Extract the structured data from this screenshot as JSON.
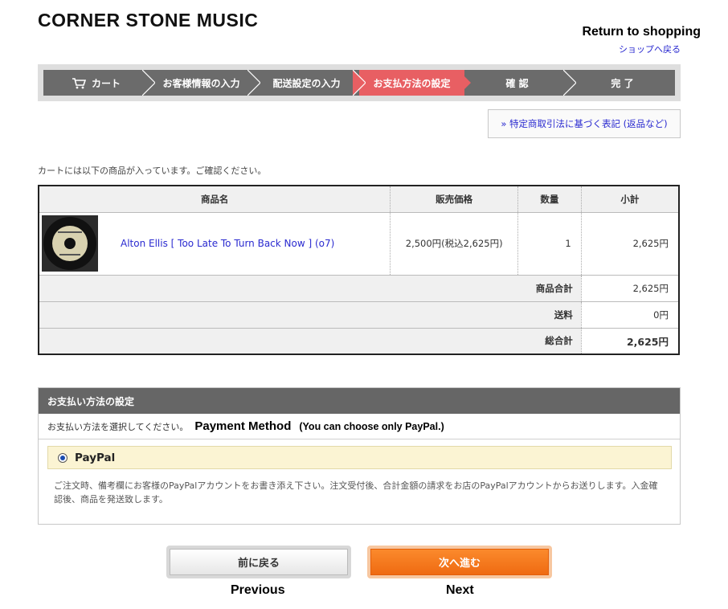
{
  "header": {
    "store_title": "CORNER STONE MUSIC",
    "return_en": "Return to shopping",
    "return_jp": "ショップへ戻る"
  },
  "steps": [
    {
      "label": "カート",
      "icon": "cart-icon",
      "active": false
    },
    {
      "label": "お客様情報の入力",
      "active": false
    },
    {
      "label": "配送設定の入力",
      "active": false
    },
    {
      "label": "お支払方法の設定",
      "active": true
    },
    {
      "label": "確 認",
      "active": false
    },
    {
      "label": "完 了",
      "active": false
    }
  ],
  "legal_link": "» 特定商取引法に基づく表記 (返品など)",
  "cart": {
    "intro": "カートには以下の商品が入っています。ご確認ください。",
    "headers": {
      "name": "商品名",
      "price": "販売価格",
      "qty": "数量",
      "subtotal": "小計"
    },
    "item": {
      "name": "Alton Ellis [ Too Late To Turn Back Now ] (o7)",
      "price": "2,500円(税込2,625円)",
      "qty": "1",
      "subtotal": "2,625円"
    },
    "summary": {
      "goods_label": "商品合計",
      "goods_value": "2,625円",
      "shipping_label": "送料",
      "shipping_value": "0円",
      "total_label": "総合計",
      "total_value": "2,625円"
    }
  },
  "payment": {
    "heading": "お支払い方法の設定",
    "instruction": "お支払い方法を選択してください。",
    "method_title": "Payment Method",
    "method_note": "(You can choose only PayPal.)",
    "option_label": "PayPal",
    "option_selected": true,
    "description": "ご注文時、備考欄にお客様のPayPalアカウントをお書き添え下さい。注文受付後、合計金額の請求をお店のPayPalアカウントからお送りします。入金確認後、商品を発送致します。"
  },
  "buttons": {
    "prev_label": "前に戻る",
    "next_label": "次へ進む",
    "prev_caption": "Previous",
    "next_caption": "Next"
  },
  "colors": {
    "active_step": "#e85f63",
    "step_bar": "#6b6b6b",
    "link": "#2a2ad0",
    "next_button": "#ef6a12",
    "paypal_option_bg": "#fbf4d3"
  }
}
